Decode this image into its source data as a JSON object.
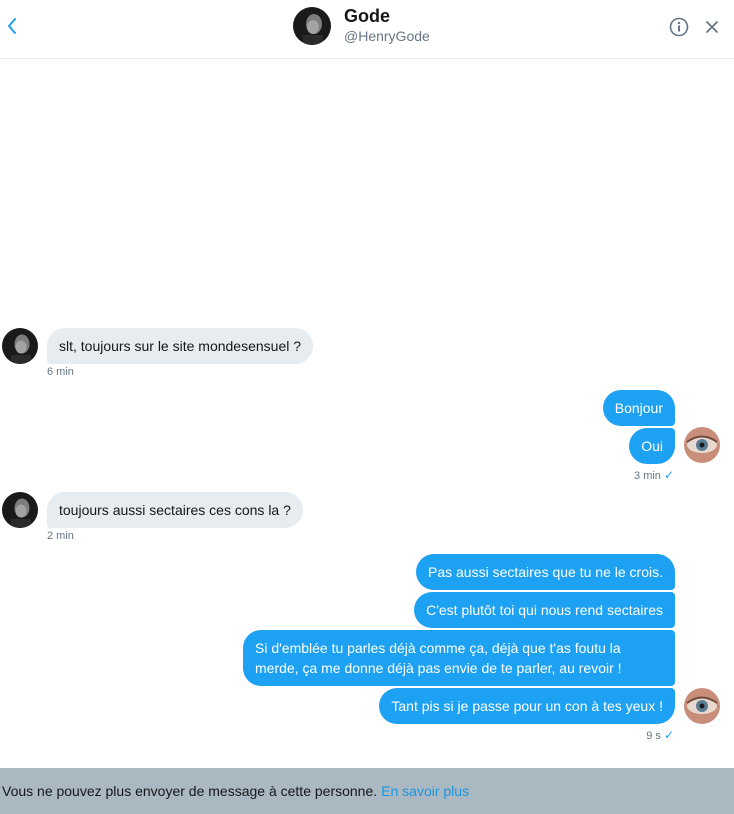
{
  "header": {
    "name": "Gode",
    "handle": "@HenryGode",
    "back_icon": "chevron-left-icon",
    "info_icon": "info-icon",
    "close_icon": "close-icon"
  },
  "messages": [
    {
      "direction": "in",
      "text": "slt, toujours sur le site mondesensuel ?",
      "time": "6 min"
    },
    {
      "direction": "out",
      "text": "Bonjour"
    },
    {
      "direction": "out",
      "text": "Oui",
      "time": "3 min",
      "check": "✓"
    },
    {
      "direction": "in",
      "text": "toujours aussi sectaires ces cons la ?",
      "time": "2 min"
    },
    {
      "direction": "out",
      "text": "Pas aussi sectaires que tu ne le crois."
    },
    {
      "direction": "out",
      "text": "C'est plutôt toi qui nous rend sectaires"
    },
    {
      "direction": "out",
      "text": "Si d'emblée tu parles déjà comme ça, déjà que t'as foutu la merde, ça me donne déjà pas envie de te parler, au revoir !"
    },
    {
      "direction": "out",
      "text": "Tant pis si je passe pour un con à tes yeux !",
      "time": "9 s",
      "check": "✓"
    }
  ],
  "footer": {
    "text": "Vous ne pouvez plus envoyer de message à cette personne.",
    "link": "En savoir plus"
  },
  "colors": {
    "accent": "#1da1f2",
    "incoming_bubble": "#e6ecf0",
    "footer_bg": "#aab8c2"
  }
}
